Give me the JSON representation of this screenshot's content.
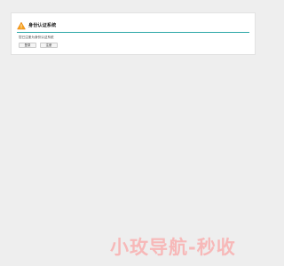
{
  "dialog": {
    "title": "身份认证系统",
    "message": "您已注册为身份认证系统",
    "buttons": {
      "primary_label": "登录",
      "secondary_label": "注册"
    }
  },
  "watermark": {
    "text": "小玫导航-秒收"
  },
  "colors": {
    "accent": "#2aa6a6",
    "warning_orange": "#e37a14",
    "page_background": "#eeeeee",
    "card_background": "#ffffff"
  },
  "icons": {
    "warning": "warning-triangle-icon"
  }
}
